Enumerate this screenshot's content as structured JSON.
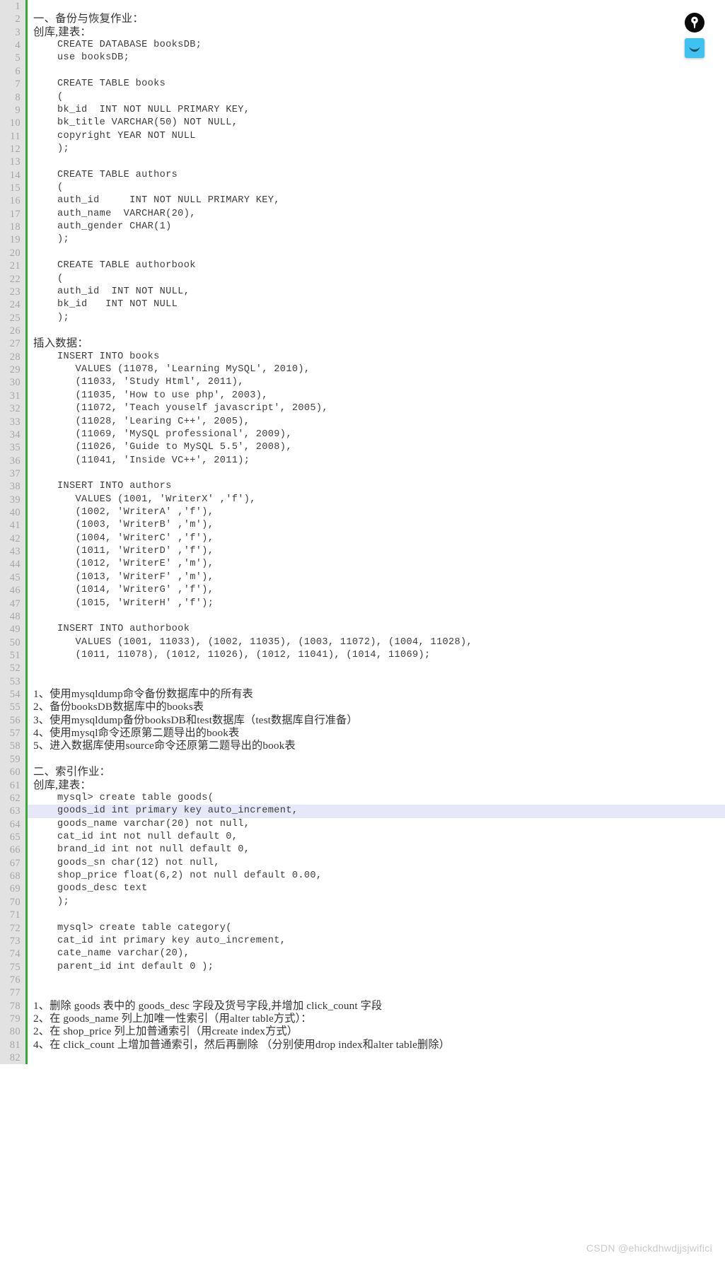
{
  "window": {
    "background_color": "#ffffff",
    "gutter_color": "#e2e2e2",
    "gutter_text_color": "#a6a6a6",
    "accent_rule_color": "#33aa33",
    "highlight_color": "#e7e7fa",
    "code_text_color": "#3c3c3c"
  },
  "float_icons": [
    {
      "name": "pen-nib-icon",
      "glyph": "pen",
      "color": "#0b0b0b"
    },
    {
      "name": "markdown-editor-icon",
      "glyph": "smile",
      "color": "#3fc2ef"
    }
  ],
  "watermark": "CSDN @ehickdhwdjjsjwifici",
  "editor": {
    "highlighted_line": 63,
    "total_lines": 82,
    "lines": [
      {
        "n": 1,
        "text": "",
        "style": "code"
      },
      {
        "n": 2,
        "text": "一、备份与恢复作业：",
        "style": "prose"
      },
      {
        "n": 3,
        "text": "创库,建表：",
        "style": "prose"
      },
      {
        "n": 4,
        "text": "    CREATE DATABASE booksDB;",
        "style": "code"
      },
      {
        "n": 5,
        "text": "    use booksDB;",
        "style": "code"
      },
      {
        "n": 6,
        "text": "",
        "style": "code"
      },
      {
        "n": 7,
        "text": "    CREATE TABLE books",
        "style": "code"
      },
      {
        "n": 8,
        "text": "    (",
        "style": "code"
      },
      {
        "n": 9,
        "text": "    bk_id  INT NOT NULL PRIMARY KEY,",
        "style": "code"
      },
      {
        "n": 10,
        "text": "    bk_title VARCHAR(50) NOT NULL,",
        "style": "code"
      },
      {
        "n": 11,
        "text": "    copyright YEAR NOT NULL",
        "style": "code"
      },
      {
        "n": 12,
        "text": "    );",
        "style": "code"
      },
      {
        "n": 13,
        "text": "",
        "style": "code"
      },
      {
        "n": 14,
        "text": "    CREATE TABLE authors",
        "style": "code"
      },
      {
        "n": 15,
        "text": "    (",
        "style": "code"
      },
      {
        "n": 16,
        "text": "    auth_id     INT NOT NULL PRIMARY KEY,",
        "style": "code"
      },
      {
        "n": 17,
        "text": "    auth_name  VARCHAR(20),",
        "style": "code"
      },
      {
        "n": 18,
        "text": "    auth_gender CHAR(1)",
        "style": "code"
      },
      {
        "n": 19,
        "text": "    );",
        "style": "code"
      },
      {
        "n": 20,
        "text": "",
        "style": "code"
      },
      {
        "n": 21,
        "text": "    CREATE TABLE authorbook",
        "style": "code"
      },
      {
        "n": 22,
        "text": "    (",
        "style": "code"
      },
      {
        "n": 23,
        "text": "    auth_id  INT NOT NULL,",
        "style": "code"
      },
      {
        "n": 24,
        "text": "    bk_id   INT NOT NULL",
        "style": "code"
      },
      {
        "n": 25,
        "text": "    );",
        "style": "code"
      },
      {
        "n": 26,
        "text": "",
        "style": "code"
      },
      {
        "n": 27,
        "text": "插入数据：",
        "style": "prose"
      },
      {
        "n": 28,
        "text": "    INSERT INTO books",
        "style": "code"
      },
      {
        "n": 29,
        "text": "       VALUES (11078, 'Learning MySQL', 2010),",
        "style": "code"
      },
      {
        "n": 30,
        "text": "       (11033, 'Study Html', 2011),",
        "style": "code"
      },
      {
        "n": 31,
        "text": "       (11035, 'How to use php', 2003),",
        "style": "code"
      },
      {
        "n": 32,
        "text": "       (11072, 'Teach youself javascript', 2005),",
        "style": "code"
      },
      {
        "n": 33,
        "text": "       (11028, 'Learing C++', 2005),",
        "style": "code"
      },
      {
        "n": 34,
        "text": "       (11069, 'MySQL professional', 2009),",
        "style": "code"
      },
      {
        "n": 35,
        "text": "       (11026, 'Guide to MySQL 5.5', 2008),",
        "style": "code"
      },
      {
        "n": 36,
        "text": "       (11041, 'Inside VC++', 2011);",
        "style": "code"
      },
      {
        "n": 37,
        "text": "",
        "style": "code"
      },
      {
        "n": 38,
        "text": "    INSERT INTO authors",
        "style": "code"
      },
      {
        "n": 39,
        "text": "       VALUES (1001, 'WriterX' ,'f'),",
        "style": "code"
      },
      {
        "n": 40,
        "text": "       (1002, 'WriterA' ,'f'),",
        "style": "code"
      },
      {
        "n": 41,
        "text": "       (1003, 'WriterB' ,'m'),",
        "style": "code"
      },
      {
        "n": 42,
        "text": "       (1004, 'WriterC' ,'f'),",
        "style": "code"
      },
      {
        "n": 43,
        "text": "       (1011, 'WriterD' ,'f'),",
        "style": "code"
      },
      {
        "n": 44,
        "text": "       (1012, 'WriterE' ,'m'),",
        "style": "code"
      },
      {
        "n": 45,
        "text": "       (1013, 'WriterF' ,'m'),",
        "style": "code"
      },
      {
        "n": 46,
        "text": "       (1014, 'WriterG' ,'f'),",
        "style": "code"
      },
      {
        "n": 47,
        "text": "       (1015, 'WriterH' ,'f');",
        "style": "code"
      },
      {
        "n": 48,
        "text": "",
        "style": "code"
      },
      {
        "n": 49,
        "text": "    INSERT INTO authorbook",
        "style": "code"
      },
      {
        "n": 50,
        "text": "       VALUES (1001, 11033), (1002, 11035), (1003, 11072), (1004, 11028),",
        "style": "code"
      },
      {
        "n": 51,
        "text": "       (1011, 11078), (1012, 11026), (1012, 11041), (1014, 11069);",
        "style": "code"
      },
      {
        "n": 52,
        "text": "",
        "style": "code"
      },
      {
        "n": 53,
        "text": "",
        "style": "code"
      },
      {
        "n": 54,
        "text": "1、使用mysqldump命令备份数据库中的所有表",
        "style": "mixed"
      },
      {
        "n": 55,
        "text": "2、备份booksDB数据库中的books表",
        "style": "mixed"
      },
      {
        "n": 56,
        "text": "3、使用mysqldump备份booksDB和test数据库（test数据库自行准备）",
        "style": "mixed"
      },
      {
        "n": 57,
        "text": "4、使用mysql命令还原第二题导出的book表",
        "style": "mixed"
      },
      {
        "n": 58,
        "text": "5、进入数据库使用source命令还原第二题导出的book表",
        "style": "mixed"
      },
      {
        "n": 59,
        "text": "",
        "style": "code"
      },
      {
        "n": 60,
        "text": "二、索引作业：",
        "style": "prose"
      },
      {
        "n": 61,
        "text": "创库,建表：",
        "style": "prose"
      },
      {
        "n": 62,
        "text": "    mysql> create table goods(",
        "style": "code"
      },
      {
        "n": 63,
        "text": "    goods_id int primary key auto_increment,",
        "style": "code"
      },
      {
        "n": 64,
        "text": "    goods_name varchar(20) not null,",
        "style": "code"
      },
      {
        "n": 65,
        "text": "    cat_id int not null default 0,",
        "style": "code"
      },
      {
        "n": 66,
        "text": "    brand_id int not null default 0,",
        "style": "code"
      },
      {
        "n": 67,
        "text": "    goods_sn char(12) not null,",
        "style": "code"
      },
      {
        "n": 68,
        "text": "    shop_price float(6,2) not null default 0.00,",
        "style": "code"
      },
      {
        "n": 69,
        "text": "    goods_desc text",
        "style": "code"
      },
      {
        "n": 70,
        "text": "    );",
        "style": "code"
      },
      {
        "n": 71,
        "text": "",
        "style": "code"
      },
      {
        "n": 72,
        "text": "    mysql> create table category(",
        "style": "code"
      },
      {
        "n": 73,
        "text": "    cat_id int primary key auto_increment,",
        "style": "code"
      },
      {
        "n": 74,
        "text": "    cate_name varchar(20),",
        "style": "code"
      },
      {
        "n": 75,
        "text": "    parent_id int default 0 );",
        "style": "code"
      },
      {
        "n": 76,
        "text": "",
        "style": "code"
      },
      {
        "n": 77,
        "text": "",
        "style": "code"
      },
      {
        "n": 78,
        "text": "1、删除 goods 表中的 goods_desc 字段及货号字段,并增加 click_count 字段",
        "style": "mixed"
      },
      {
        "n": 79,
        "text": "2、在 goods_name 列上加唯一性索引（用alter table方式）：",
        "style": "mixed"
      },
      {
        "n": 80,
        "text": "2、在 shop_price 列上加普通索引（用create index方式）",
        "style": "mixed"
      },
      {
        "n": 81,
        "text": "4、在 click_count 上增加普通索引，然后再删除 （分别使用drop index和alter table删除）",
        "style": "mixed"
      },
      {
        "n": 82,
        "text": "",
        "style": "code"
      }
    ]
  }
}
